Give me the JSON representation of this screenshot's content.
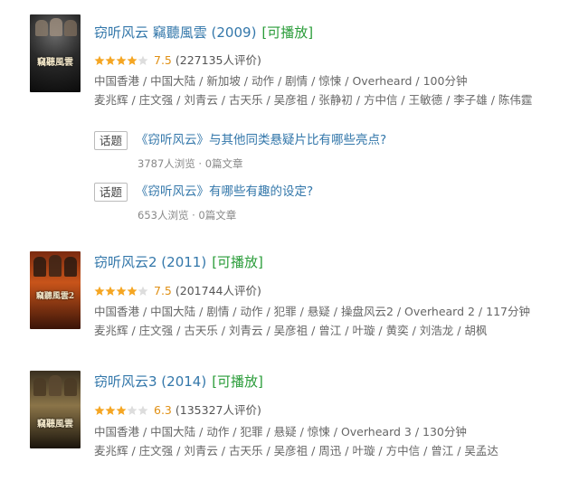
{
  "colors": {
    "title": "#3377aa",
    "playable": "#2a9c39",
    "score": "#e09015",
    "star_on": "#f5a623",
    "star_off": "#dddddd"
  },
  "movies": [
    {
      "title": "窃听风云 竊聽風雲 (2009)",
      "playable": "[可播放]",
      "rating": "7.5",
      "stars_filled": 4,
      "votes": "(227135人评价)",
      "meta": "中国香港 / 中国大陆 / 新加坡 / 动作 / 剧情 / 惊悚 / Overheard / 100分钟",
      "cast": "麦兆辉 / 庄文强 / 刘青云 / 古天乐 / 吴彦祖 / 张静初 / 方中信 / 王敏德 / 李子雄 / 陈伟霆",
      "poster_text": "竊聽風雲",
      "topics": [
        {
          "badge": "话题",
          "title": "《窃听风云》与其他同类悬疑片比有哪些亮点?",
          "stats": "3787人浏览 · 0篇文章"
        },
        {
          "badge": "话题",
          "title": "《窃听风云》有哪些有趣的设定?",
          "stats": "653人浏览 · 0篇文章"
        }
      ]
    },
    {
      "title": "窃听风云2 (2011)",
      "playable": "[可播放]",
      "rating": "7.5",
      "stars_filled": 4,
      "votes": "(201744人评价)",
      "meta": "中国香港 / 中国大陆 / 剧情 / 动作 / 犯罪 / 悬疑 / 操盘风云2 / Overheard 2 / 117分钟",
      "cast": "麦兆辉 / 庄文强 / 古天乐 / 刘青云 / 吴彦祖 / 曾江 / 叶璇 / 黄奕 / 刘浩龙 / 胡枫",
      "poster_text": "竊聽風雲2"
    },
    {
      "title": "窃听风云3 (2014)",
      "playable": "[可播放]",
      "rating": "6.3",
      "stars_filled": 3,
      "votes": "(135327人评价)",
      "meta": "中国香港 / 中国大陆 / 动作 / 犯罪 / 悬疑 / 惊悚 / Overheard 3 / 130分钟",
      "cast": "麦兆辉 / 庄文强 / 刘青云 / 古天乐 / 吴彦祖 / 周迅 / 叶璇 / 方中信 / 曾江 / 吴孟达",
      "poster_text": "竊聽風雲"
    }
  ]
}
